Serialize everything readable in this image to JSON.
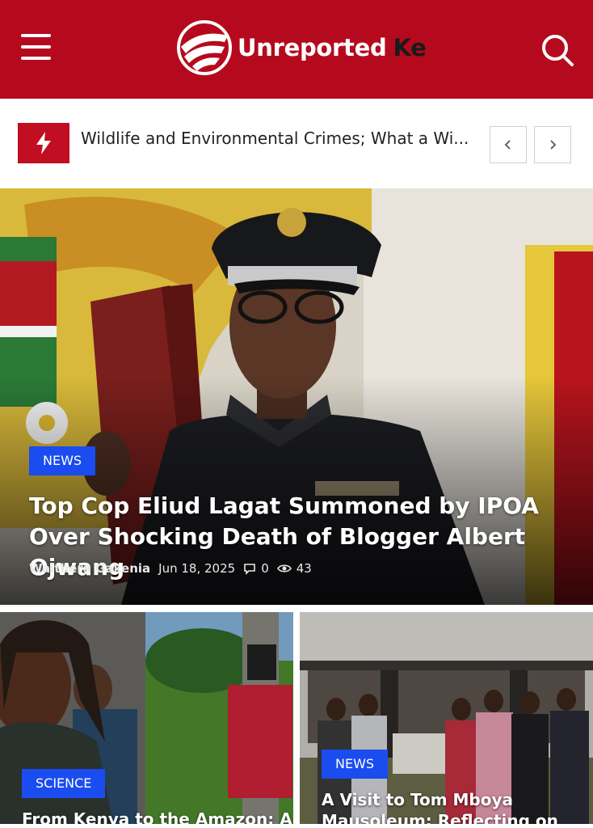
{
  "header": {
    "brand_main": "Unreported",
    "brand_accent": "Ke",
    "menu_icon": "hamburger-menu-icon",
    "search_icon": "search-icon",
    "brand_color": "#b50a1d"
  },
  "ticker": {
    "icon": "lightning-bolt-icon",
    "headline": "Wildlife and Environmental Crimes; What a Wi...",
    "prev_icon": "chevron-left-icon",
    "next_icon": "chevron-right-icon"
  },
  "featured": {
    "category": "NEWS",
    "title": "Top Cop Eliud Lagat Summoned by IPOA Over Shocking Death of Blogger Albert Ojwang",
    "author": "Waithera Gakenia",
    "date": "Jun 18, 2025",
    "comments": "0",
    "views": "43",
    "badge_color": "#1a4cf0"
  },
  "cards": [
    {
      "category": "SCIENCE",
      "title": "From Kenya to the Amazon: A"
    },
    {
      "category": "NEWS",
      "title": "A Visit to Tom Mboya Mausoleum: Reflecting on"
    }
  ]
}
